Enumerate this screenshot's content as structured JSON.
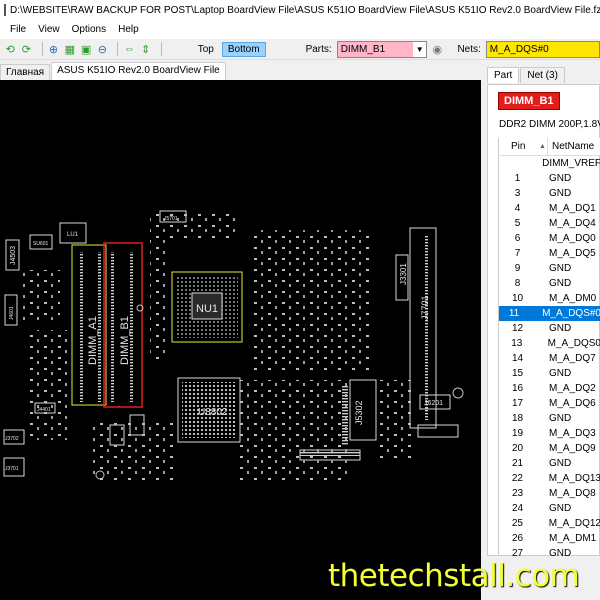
{
  "window": {
    "title": "D:\\WEBSITE\\RAW BACKUP FOR POST\\Laptop BoardView File\\ASUS K51IO BoardView File\\ASUS K51IO Rev2.0 BoardView File.fz"
  },
  "menu": {
    "items": [
      "File",
      "View",
      "Options",
      "Help"
    ]
  },
  "toolbar": {
    "top_label": "Top",
    "bottom_label": "Bottom",
    "parts_label": "Parts:",
    "parts_value": "DIMM_B1",
    "nets_label": "Nets:",
    "nets_value": "M_A_DQS#0"
  },
  "tabs": {
    "main": "Главная",
    "file": "ASUS K51IO Rev2.0 BoardView File"
  },
  "board": {
    "labels": [
      "DIMM_A1",
      "DIMM_B1",
      "NU1",
      "U8802",
      "J7701",
      "J3301",
      "J5302",
      "J6201",
      "J4503",
      "J5701",
      "LU1",
      "SU601",
      "J4601",
      "J4401",
      "J3702",
      "J3701"
    ]
  },
  "right_panel": {
    "tab_part": "Part",
    "tab_net": "Net (3)",
    "part_name": "DIMM_B1",
    "part_desc": "DDR2 DIMM 200P,1.8V",
    "col_pin": "Pin",
    "col_netname": "NetName",
    "selected_index": 11,
    "rows": [
      {
        "pin": "",
        "net": "DIMM_VREF"
      },
      {
        "pin": "1",
        "net": "GND"
      },
      {
        "pin": "3",
        "net": "GND"
      },
      {
        "pin": "4",
        "net": "M_A_DQ1"
      },
      {
        "pin": "5",
        "net": "M_A_DQ4"
      },
      {
        "pin": "6",
        "net": "M_A_DQ0"
      },
      {
        "pin": "7",
        "net": "M_A_DQ5"
      },
      {
        "pin": "9",
        "net": "GND"
      },
      {
        "pin": "8",
        "net": "GND"
      },
      {
        "pin": "10",
        "net": "M_A_DM0"
      },
      {
        "pin": "11",
        "net": "M_A_DQS#0"
      },
      {
        "pin": "12",
        "net": "GND"
      },
      {
        "pin": "13",
        "net": "M_A_DQS0"
      },
      {
        "pin": "14",
        "net": "M_A_DQ7"
      },
      {
        "pin": "15",
        "net": "GND"
      },
      {
        "pin": "16",
        "net": "M_A_DQ2"
      },
      {
        "pin": "17",
        "net": "M_A_DQ6"
      },
      {
        "pin": "18",
        "net": "GND"
      },
      {
        "pin": "19",
        "net": "M_A_DQ3"
      },
      {
        "pin": "20",
        "net": "M_A_DQ9"
      },
      {
        "pin": "21",
        "net": "GND"
      },
      {
        "pin": "22",
        "net": "M_A_DQ13"
      },
      {
        "pin": "23",
        "net": "M_A_DQ8"
      },
      {
        "pin": "24",
        "net": "GND"
      },
      {
        "pin": "25",
        "net": "M_A_DQ12"
      },
      {
        "pin": "26",
        "net": "M_A_DM1"
      },
      {
        "pin": "27",
        "net": "GND"
      }
    ]
  },
  "watermark": "thetechstall.com",
  "colors": {
    "part_highlight": "#ffb6c8",
    "net_highlight": "#ffe600",
    "selected_row": "#0078d7",
    "badge": "#e31c1c",
    "board_bg": "#000000"
  }
}
